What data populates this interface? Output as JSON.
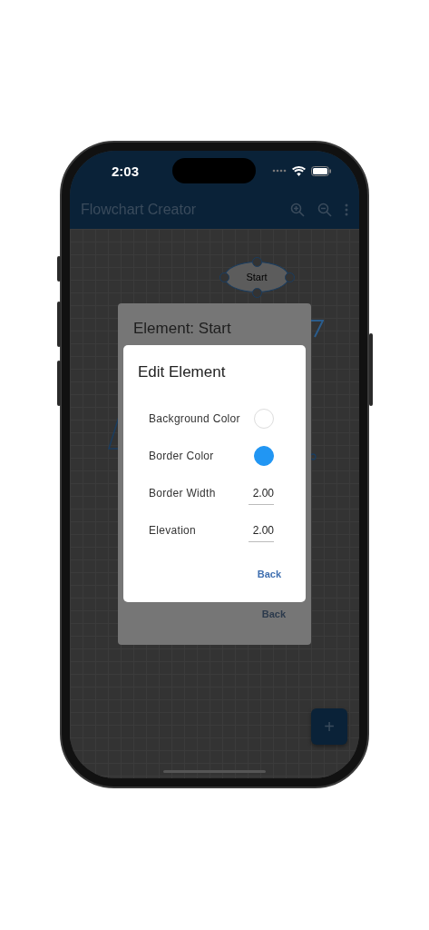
{
  "status_bar": {
    "time": "2:03"
  },
  "app_bar": {
    "title": "Flowchart Creator"
  },
  "canvas": {
    "nodes": [
      {
        "kind": "terminal",
        "label": "Start"
      }
    ]
  },
  "element_dialog": {
    "title": "Element: Start",
    "back": "Back"
  },
  "edit_dialog": {
    "title": "Edit Element",
    "back": "Back",
    "fields": [
      {
        "kind": "color",
        "label": "Background Color",
        "color": "#ffffff"
      },
      {
        "kind": "color",
        "label": "Border Color",
        "color": "#2196f3"
      },
      {
        "kind": "number",
        "label": "Border Width",
        "value": "2.00"
      },
      {
        "kind": "number",
        "label": "Elevation",
        "value": "2.00"
      }
    ]
  },
  "fab": {
    "label": "+"
  }
}
